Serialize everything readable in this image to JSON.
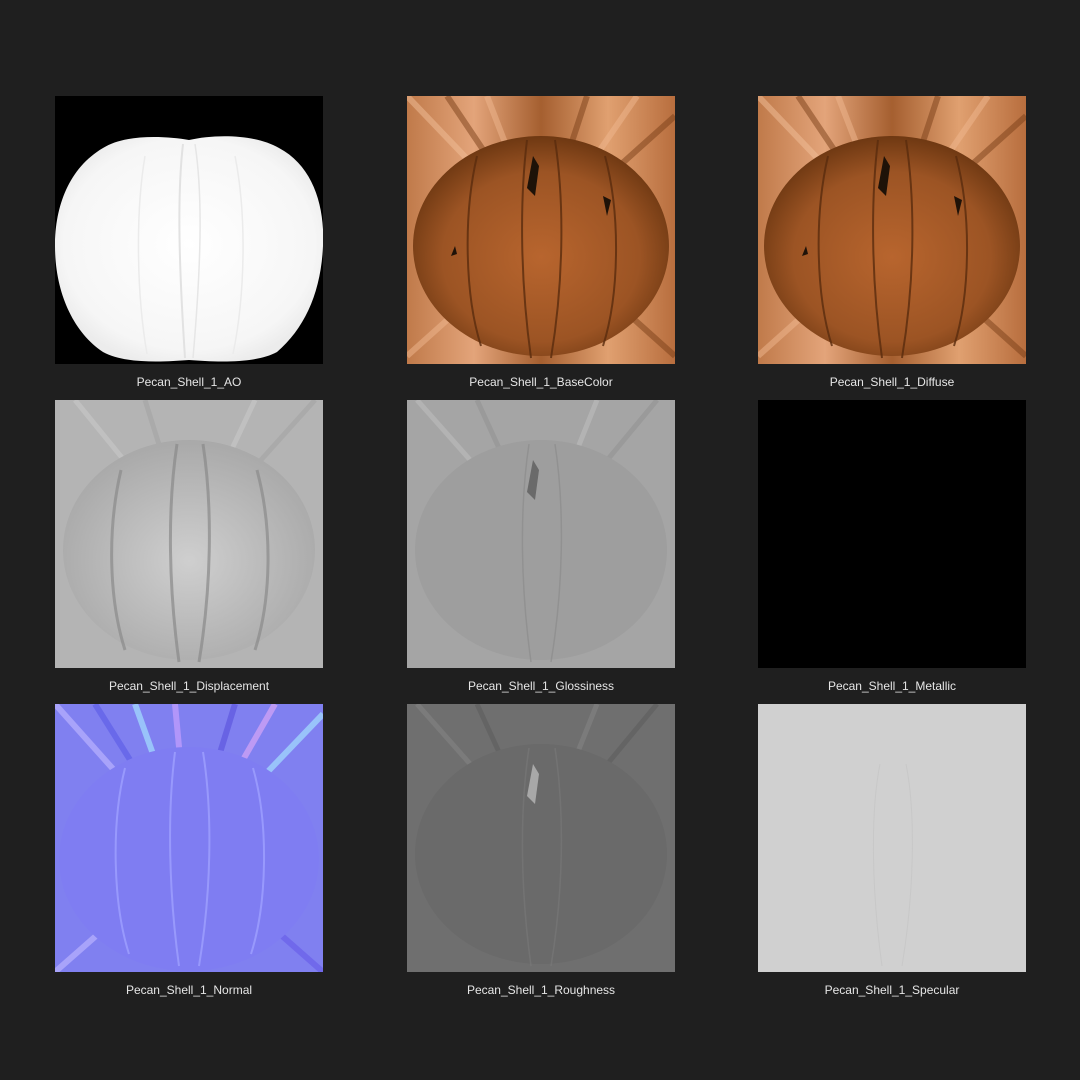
{
  "background_color": "#1f1f1f",
  "caption_color": "#e6e6e6",
  "items": [
    {
      "label": "Pecan_Shell_1_AO",
      "map": "ambient-occlusion"
    },
    {
      "label": "Pecan_Shell_1_BaseColor",
      "map": "base-color"
    },
    {
      "label": "Pecan_Shell_1_Diffuse",
      "map": "diffuse"
    },
    {
      "label": "Pecan_Shell_1_Displacement",
      "map": "displacement"
    },
    {
      "label": "Pecan_Shell_1_Glossiness",
      "map": "glossiness"
    },
    {
      "label": "Pecan_Shell_1_Metallic",
      "map": "metallic"
    },
    {
      "label": "Pecan_Shell_1_Normal",
      "map": "normal"
    },
    {
      "label": "Pecan_Shell_1_Roughness",
      "map": "roughness"
    },
    {
      "label": "Pecan_Shell_1_Specular",
      "map": "specular"
    }
  ]
}
